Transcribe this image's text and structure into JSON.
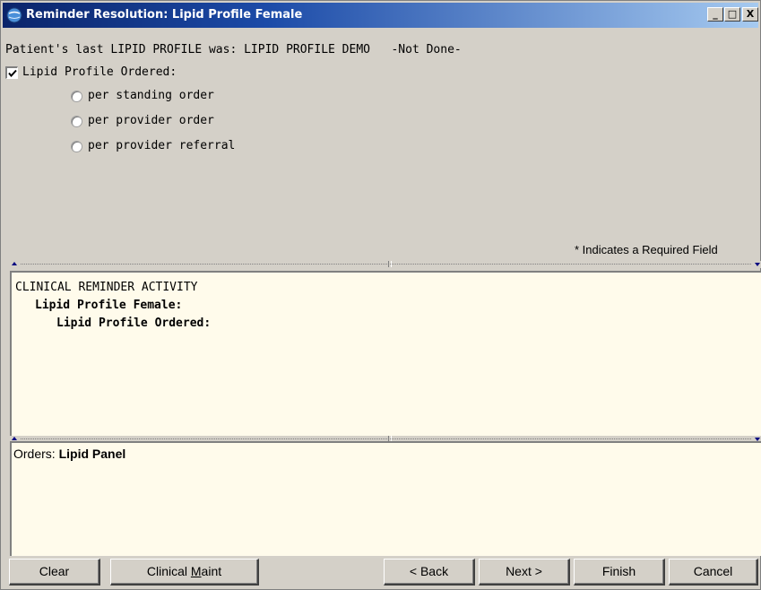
{
  "window": {
    "title": "Reminder Resolution: Lipid Profile Female",
    "controls": {
      "minimize": "_",
      "maximize": "□",
      "close": "X"
    }
  },
  "dialog": {
    "last_profile_line": "Patient's last LIPID PROFILE was: LIPID PROFILE DEMO   -Not Done-",
    "checkbox": {
      "label": "Lipid Profile Ordered:",
      "checked": true
    },
    "radio_options": [
      {
        "label": "per standing order",
        "selected": false
      },
      {
        "label": "per provider order",
        "selected": false
      },
      {
        "label": "per provider referral",
        "selected": false
      }
    ],
    "required_note": "* Indicates a Required Field"
  },
  "activity": {
    "header": "CLINICAL REMINDER ACTIVITY",
    "reminder": "Lipid Profile Female:",
    "item": "Lipid Profile Ordered:"
  },
  "orders": {
    "label": "Orders:",
    "value": "Lipid Panel"
  },
  "buttons": {
    "clear": "Clear",
    "clinical_maint_prefix": "Clinical ",
    "clinical_maint_mnemonic": "M",
    "clinical_maint_suffix": "aint",
    "back": "< Back",
    "next": "Next >",
    "finish": "Finish",
    "cancel": "Cancel"
  },
  "colors": {
    "title_gradient_start": "#0a246a",
    "title_gradient_end": "#a6caf0",
    "panel_background": "#fffbeb",
    "dialog_background": "#d4d0c8"
  },
  "icons": [
    "app-globe-icon",
    "minimize-icon",
    "maximize-icon",
    "close-icon",
    "checkmark-icon",
    "radio-icon"
  ]
}
